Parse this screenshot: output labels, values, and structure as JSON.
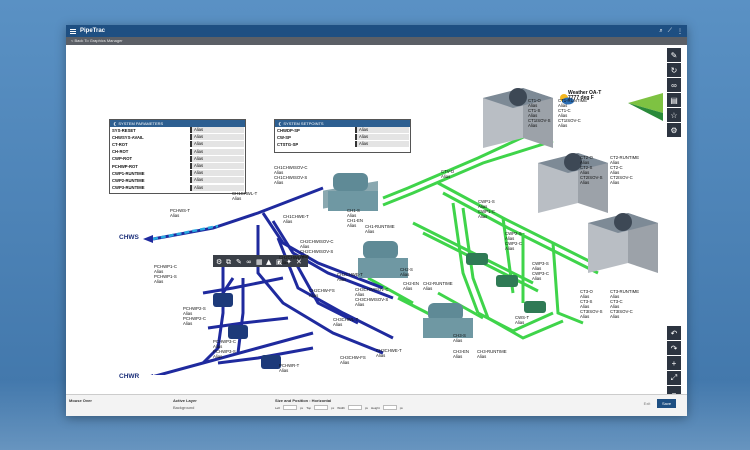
{
  "app": {
    "title": "PipeTrac",
    "back_link": "< Back To Graphics Manager"
  },
  "weather": {
    "line1": "Weather OA-T",
    "line2": "7777 deg F"
  },
  "panels": {
    "system_parameters": {
      "title": "SYSTEM PARAMETERS",
      "rows": [
        {
          "name": "SYS-RESET",
          "value": "Alias"
        },
        {
          "name": "CHWSYS-AVAIL",
          "value": "Alias"
        },
        {
          "name": "CT-ROT",
          "value": "Alias"
        },
        {
          "name": "CH-ROT",
          "value": "Alias"
        },
        {
          "name": "CWP-ROT",
          "value": "Alias"
        },
        {
          "name": "PCHWP-ROT",
          "value": "Alias"
        },
        {
          "name": "CWP1-RUNTIME",
          "value": "Alias"
        },
        {
          "name": "CWP2-RUNTIME",
          "value": "Alias"
        },
        {
          "name": "CWP3-RUNTIME",
          "value": "Alias"
        }
      ]
    },
    "system_setpoints": {
      "title": "SYSTEM SETPOINTS",
      "rows": [
        {
          "name": "CHWDP-SP",
          "value": "Alias"
        },
        {
          "name": "CW-SP",
          "value": "Alias"
        },
        {
          "name": "CTSTG-SP",
          "value": "Alias"
        }
      ]
    }
  },
  "labels": {
    "chws": "CHWS",
    "chwr": "CHWR",
    "pchws_t": "PCHWS-T\nAlias",
    "pchwr_t": "PCHWR-T\nAlias",
    "pchwp1": "PCHWP1-C\nAlias\nPCHWP1-S\nAlias",
    "pchwp2": "PCHWP2-S\nAlias\nPCHWP2-C\nAlias",
    "pchwp3": "PCHWP3-C\nAlias\nPCHWP3-S\nAlias",
    "ch1_isov": "CH1CHWISOV-C\nAlias\nCH1CHWISOV-S\nAlias",
    "ch1_chwl": "CH1CHWL-T\nAlias",
    "ch1_chwe": "CH1CHWE-T\nAlias",
    "ch1_s": "CH1-S\nAlias\nCH1-EN\nAlias",
    "ch1_run": "CH1-RUNTIME\nAlias",
    "ch2_isov": "CH2CHWISOV-C\nAlias\nCH2CHWISOV-S\nAlias",
    "ch2_chwl": "CH2CHWL-T\nAlias",
    "ch2_chwe": "CH2CHWE-T\nAlias",
    "ch2_chwfs": "CH2CHW-FS\nAlias",
    "ch2_s": "CH2-S\nAlias",
    "ch2_en": "CH2-EN\nAlias",
    "ch2_run": "CH2-RUNTIME\nAlias",
    "ch3_isov": "CH3CHWISOV-C\nAlias\nCH3CHWISOV-S\nAlias",
    "ch3_chwl": "CH3CHWL-T\nAlias",
    "ch3_chwe": "CH3CHWE-T\nAlias",
    "ch3_chwfs": "CH3CHW-FS\nAlias",
    "ch3_s": "CH3-S\nAlias",
    "ch3_en": "CH3-EN\nAlias",
    "ch3_run": "CH3-RUNTIME\nAlias",
    "ctv_o": "CTV-O\nAlias",
    "cwp1": "CWP1-S\nAlias\nCWP1-C\nAlias",
    "cwp2": "CWP2-S\nAlias\nCWP2-C\nAlias",
    "cwp3": "CWP3-S\nAlias\nCWP3-C\nAlias",
    "cws_t": "CWS-T\nAlias",
    "ct1_left": "CT1-O\nAlias\nCT1-S\nAlias\nCT1ISOV-S\nAlias",
    "ct1_right": "CT1-RUNTIME\nAlias\nCT1-C\nAlias\nCT1ISOV-C\nAlias",
    "ct2_left": "CT2-O\nAlias\nCT2-S\nAlias\nCT2ISOV-S\nAlias",
    "ct2_right": "CT2-RUNTIME\nAlias\nCT2-C\nAlias\nCT2ISOV-C\nAlias",
    "ct3_left": "CT3-O\nAlias\nCT3-S\nAlias\nCT3ISOV-S\nAlias",
    "ct3_right": "CT3-RUNTIME\nAlias\nCT3-C\nAlias\nCT3ISOV-C\nAlias"
  },
  "bottom": {
    "mouse_over": "Mouse Over",
    "active_layer": "Active Layer",
    "active_layer_value": "Background",
    "size_position": "Size and Position : Horizontal",
    "left": "Left",
    "top": "Top",
    "width": "Width",
    "height": "Height",
    "unit": "px",
    "exit": "Exit",
    "save": "Save"
  },
  "colors": {
    "header": "#1e4f82",
    "blue_pipe": "#1f2a9e",
    "green_pipe": "#3fd44a"
  }
}
